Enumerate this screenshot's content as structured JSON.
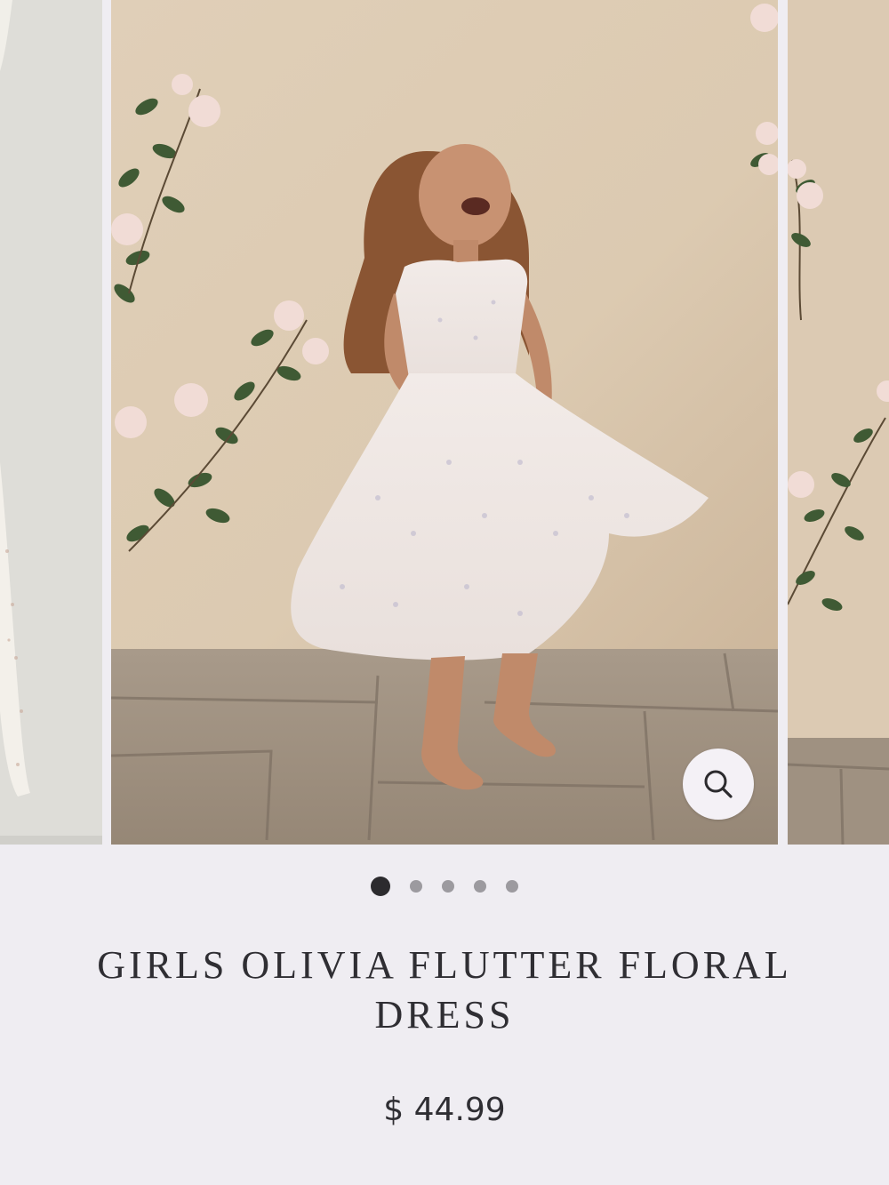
{
  "carousel": {
    "slides": [
      "Previous product photo",
      "Girl twirling in floral dress",
      "Next product photo"
    ],
    "zoom_icon": "search-icon",
    "dots": [
      {
        "active": true
      },
      {
        "active": false
      },
      {
        "active": false
      },
      {
        "active": false
      },
      {
        "active": false
      }
    ]
  },
  "product": {
    "title": "GIRLS OLIVIA FLUTTER FLORAL DRESS",
    "price": "$ 44.99"
  },
  "colors": {
    "background": "#efedf2",
    "text": "#2f2e33",
    "dot_active": "#2c2b2e",
    "dot_inactive": "#9c9a9f"
  }
}
